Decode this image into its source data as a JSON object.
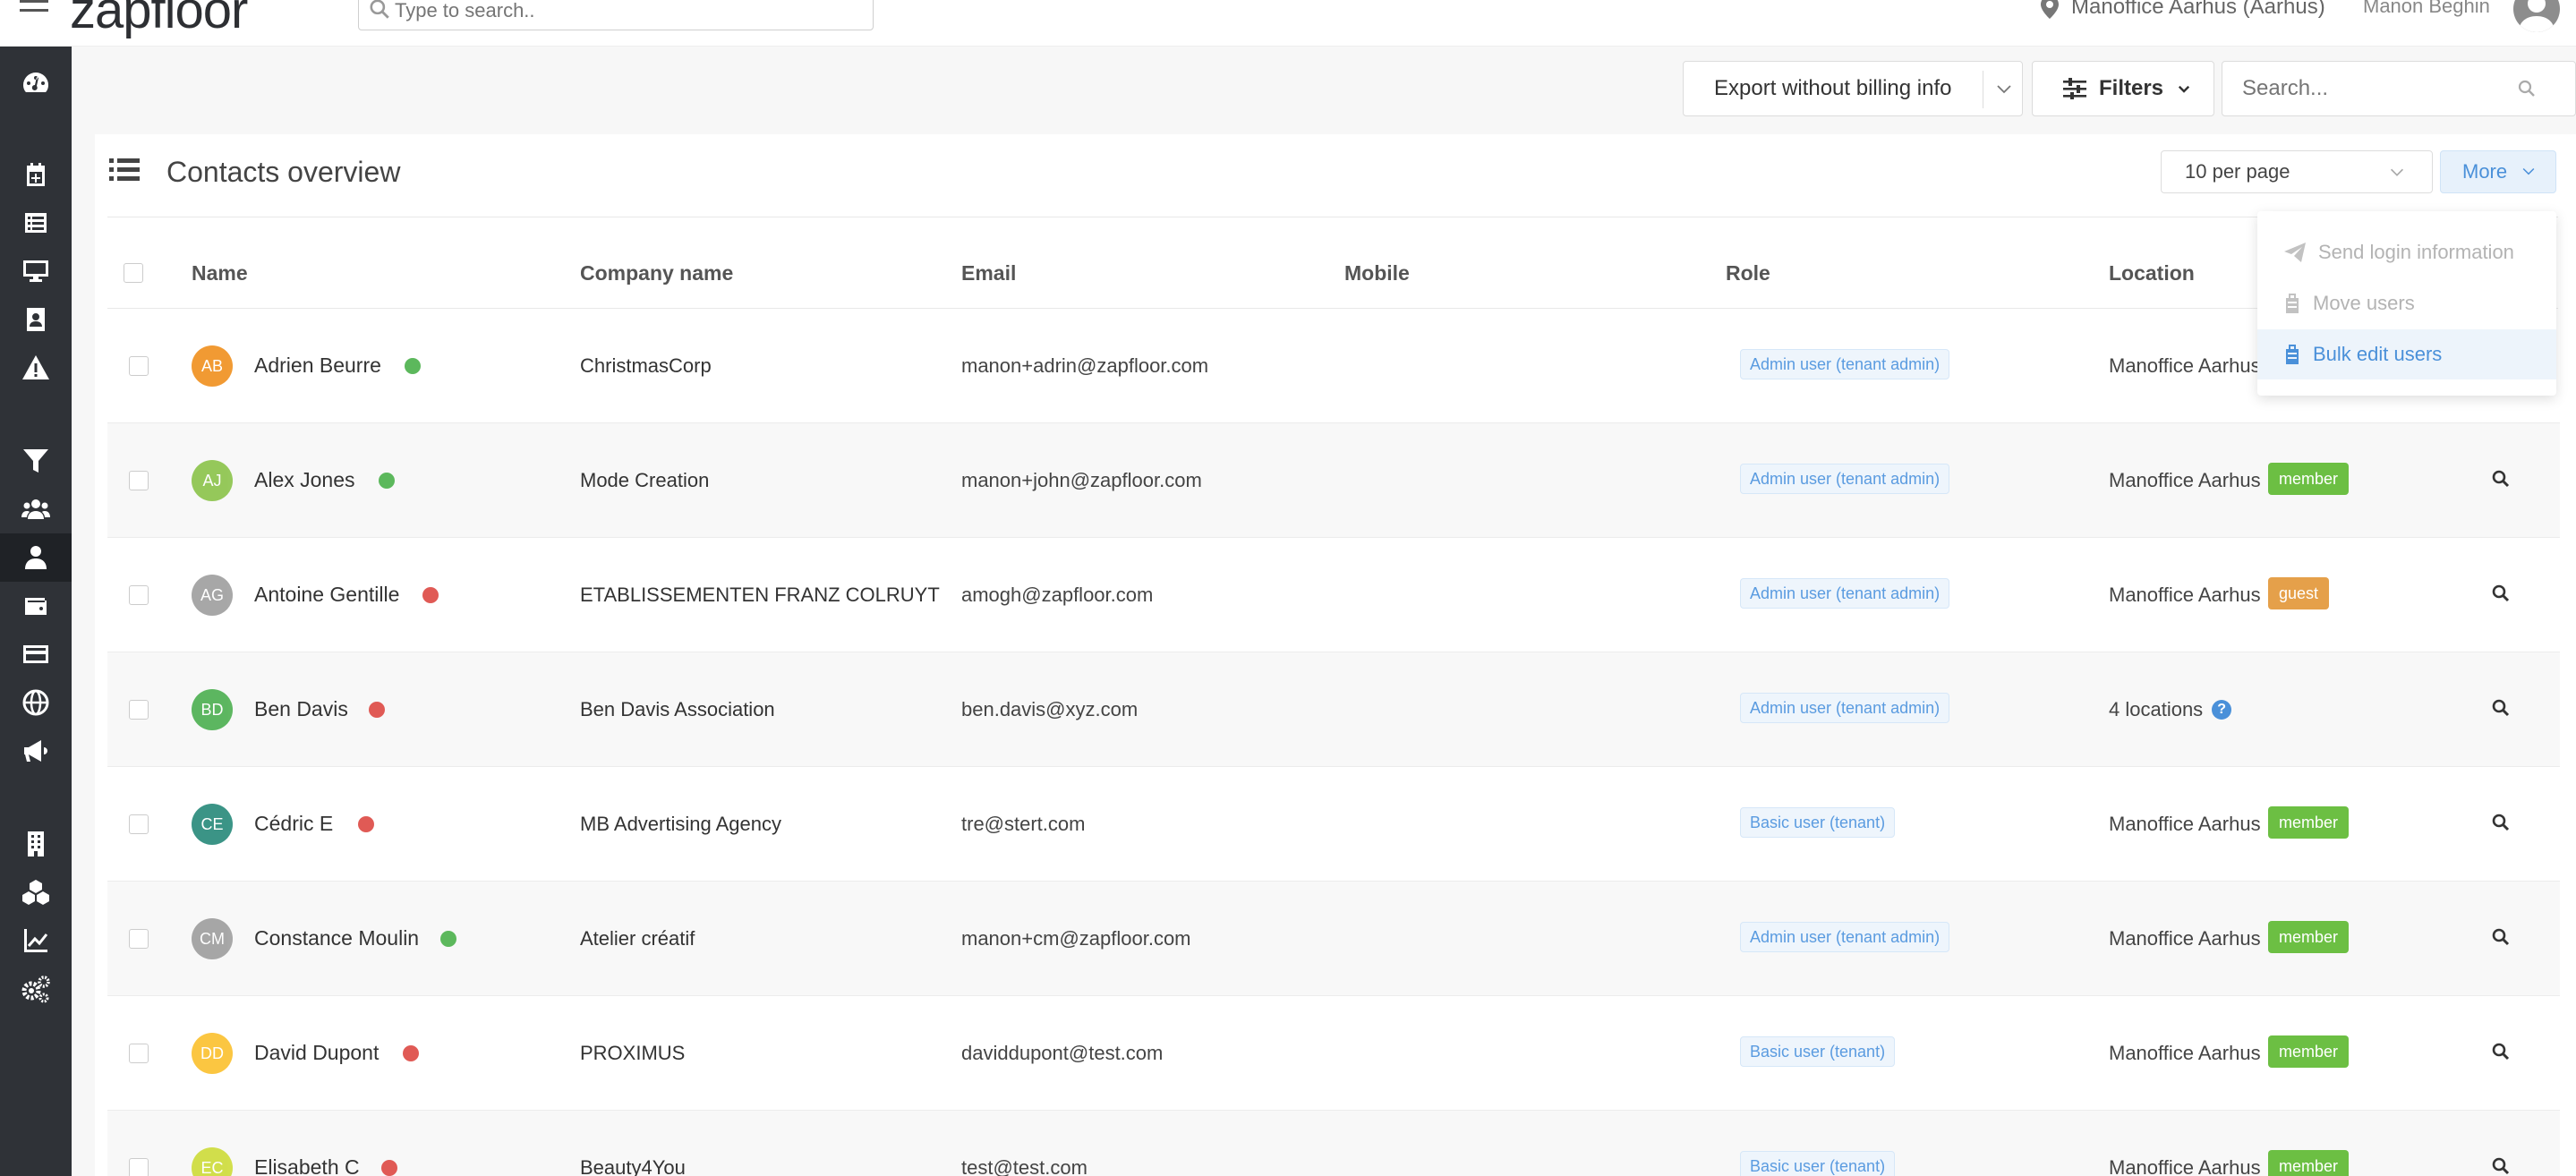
{
  "app": {
    "logo_text": "zapfloor",
    "search_placeholder": "Type to search..",
    "location": "Manoffice Aarhus (Aarhus)",
    "user_name": "Manon Beghin"
  },
  "sidebar": {
    "items": [
      {
        "name": "dashboard-icon"
      },
      {
        "name": "calendar-plus-icon"
      },
      {
        "name": "list-icon"
      },
      {
        "name": "desktop-icon"
      },
      {
        "name": "contact-card-icon"
      },
      {
        "name": "warning-icon"
      },
      {
        "name": "filter-icon"
      },
      {
        "name": "users-icon"
      },
      {
        "name": "user-icon",
        "active": true
      },
      {
        "name": "wallet-icon"
      },
      {
        "name": "credit-card-icon"
      },
      {
        "name": "globe-icon"
      },
      {
        "name": "megaphone-icon"
      },
      {
        "name": "building-icon"
      },
      {
        "name": "cubes-icon"
      },
      {
        "name": "chart-line-icon"
      },
      {
        "name": "cogs-icon"
      }
    ]
  },
  "toolbar": {
    "export_label": "Export without billing info",
    "filters_label": "Filters",
    "search_placeholder": "Search..."
  },
  "card": {
    "title": "Contacts overview",
    "per_page": "10 per page",
    "more_label": "More"
  },
  "table": {
    "columns": {
      "name": "Name",
      "company": "Company name",
      "email": "Email",
      "mobile": "Mobile",
      "role": "Role",
      "location": "Location"
    },
    "rows": [
      {
        "initials": "AB",
        "avatar_color": "#f0901e",
        "name": "Adrien Beurre",
        "status": "#5cb85c",
        "company": "ChristmasCorp",
        "email": "manon+adrin@zapfloor.com",
        "role": "Admin user (tenant admin)",
        "location": "Manoffice Aarhus",
        "badge": "",
        "badge_color": ""
      },
      {
        "initials": "AJ",
        "avatar_color": "#8bc34a",
        "name": "Alex Jones",
        "status": "#5cb85c",
        "company": "Mode Creation",
        "email": "manon+john@zapfloor.com",
        "role": "Admin user (tenant admin)",
        "location": "Manoffice Aarhus",
        "badge": "member",
        "badge_color": "#6cbf43"
      },
      {
        "initials": "AG",
        "avatar_color": "#9e9e9e",
        "name": "Antoine Gentille",
        "status": "#e05a55",
        "company": "ETABLISSEMENTEN FRANZ COLRUYT",
        "email": "amogh@zapfloor.com",
        "role": "Admin user (tenant admin)",
        "location": "Manoffice Aarhus",
        "badge": "guest",
        "badge_color": "#e5a04a"
      },
      {
        "initials": "BD",
        "avatar_color": "#4caf50",
        "name": "Ben Davis",
        "status": "#e05a55",
        "company": "Ben Davis Association",
        "email": "ben.davis@xyz.com",
        "role": "Admin user (tenant admin)",
        "location": "4 locations",
        "badge": "",
        "badge_color": "",
        "help": "?"
      },
      {
        "initials": "CE",
        "avatar_color": "#26897a",
        "name": "Cédric E",
        "status": "#e05a55",
        "company": "MB Advertising Agency",
        "email": "tre@stert.com",
        "role": "Basic user (tenant)",
        "location": "Manoffice Aarhus",
        "badge": "member",
        "badge_color": "#6cbf43"
      },
      {
        "initials": "CM",
        "avatar_color": "#9e9e9e",
        "name": "Constance Moulin",
        "status": "#5cb85c",
        "company": "Atelier créatif",
        "email": "manon+cm@zapfloor.com",
        "role": "Admin user (tenant admin)",
        "location": "Manoffice Aarhus",
        "badge": "member",
        "badge_color": "#6cbf43"
      },
      {
        "initials": "DD",
        "avatar_color": "#fbc02d",
        "name": "David Dupont",
        "status": "#e05a55",
        "company": "PROXIMUS",
        "email": "daviddupont@test.com",
        "role": "Basic user (tenant)",
        "location": "Manoffice Aarhus",
        "badge": "member",
        "badge_color": "#6cbf43"
      },
      {
        "initials": "EC",
        "avatar_color": "#cddc39",
        "name": "Elisabeth C",
        "status": "#e05a55",
        "company": "Beauty4You",
        "email": "test@test.com",
        "role": "Basic user (tenant)",
        "location": "Manoffice Aarhus",
        "badge": "member",
        "badge_color": "#6cbf43"
      }
    ]
  },
  "more_menu": {
    "items": [
      {
        "label": "Send login information",
        "icon": "paper-plane-icon"
      },
      {
        "label": "Move users",
        "icon": "suitcase-icon"
      },
      {
        "label": "Bulk edit users",
        "icon": "suitcase-icon"
      }
    ]
  }
}
